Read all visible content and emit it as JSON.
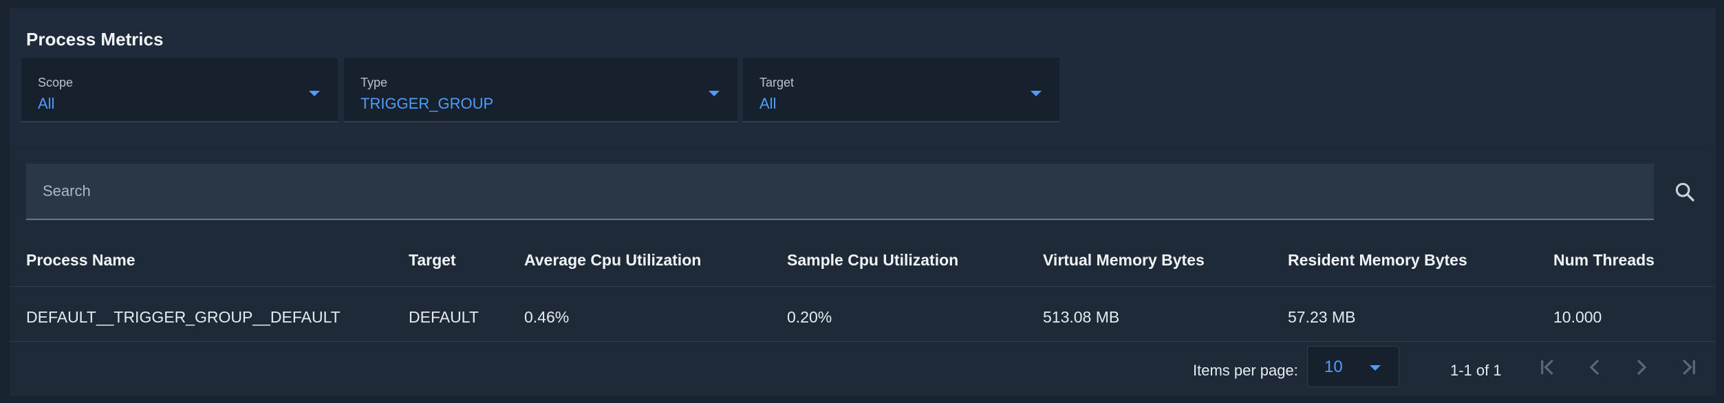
{
  "header": {
    "title": "Process Metrics"
  },
  "filters": [
    {
      "label": "Scope",
      "value": "All"
    },
    {
      "label": "Type",
      "value": "TRIGGER_GROUP"
    },
    {
      "label": "Target",
      "value": "All"
    }
  ],
  "search": {
    "placeholder": "Search",
    "value": ""
  },
  "table": {
    "columns": [
      "Process Name",
      "Target",
      "Average Cpu Utilization",
      "Sample Cpu Utilization",
      "Virtual Memory Bytes",
      "Resident Memory Bytes",
      "Num Threads"
    ],
    "rows": [
      [
        "DEFAULT__TRIGGER_GROUP__DEFAULT",
        "DEFAULT",
        "0.46%",
        "0.20%",
        "513.08 MB",
        "57.23 MB",
        "10.000"
      ]
    ]
  },
  "paginator": {
    "items_per_page_label": "Items per page:",
    "items_per_page": "10",
    "range": "1-1 of 1"
  },
  "colors": {
    "accent": "#4f9dff",
    "background": "#1a2330",
    "card": "#1e2a38"
  },
  "icons": [
    "chevron-down-icon",
    "search-icon",
    "first-page-icon",
    "previous-page-icon",
    "next-page-icon",
    "last-page-icon"
  ]
}
